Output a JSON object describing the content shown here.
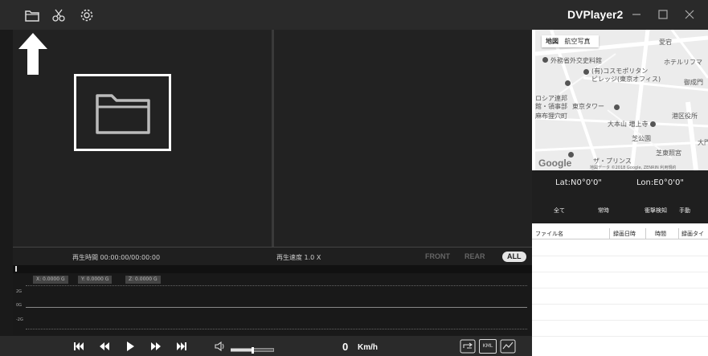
{
  "app": {
    "title": "DVPlayer2"
  },
  "toolbar": {
    "icons": [
      "folder-icon",
      "scissors-icon",
      "gear-icon"
    ]
  },
  "window_controls": [
    "minimize-icon",
    "maximize-icon",
    "close-icon"
  ],
  "status": {
    "playtime_label": "再生時間",
    "playtime_value": "00:00:00/00:00:00",
    "speed_label": "再生速度",
    "speed_value": "1.0 X",
    "view_buttons": [
      "FRONT",
      "REAR",
      "ALL"
    ],
    "active_view": "ALL"
  },
  "gsensor": {
    "x_label": "X: 0.0000 G",
    "y_label": "Y: 0.0000 G",
    "z_label": "Z: 0.0000 G",
    "ticks": [
      "2G",
      "0G",
      "-2G"
    ]
  },
  "controls": {
    "buttons": [
      "skip-start-icon",
      "rewind-icon",
      "play-icon",
      "fast-forward-icon",
      "skip-end-icon",
      "volume-icon"
    ],
    "volume_level": 0.5,
    "speed_value": "0",
    "speed_unit": "Km/h",
    "extra_buttons": [
      "loop-icon",
      "kml-icon",
      "chart-icon"
    ],
    "kml_text": "KML"
  },
  "map": {
    "tabs": [
      "地図",
      "航空写真"
    ],
    "active_tab": "地図",
    "labels": [
      "外務省外交史料館",
      "(有)コスモポリタン",
      "ビレッジ(東京オフィス)",
      "愛宕",
      "ホテルリフマ",
      "御成門",
      "ロシア連邦",
      "館・領事部",
      "東京タワー",
      "麻布狸穴町",
      "大本山 増上寺",
      "港区役所",
      "芝東照宮",
      "ザ・プリンス",
      "芝公園",
      "大門"
    ],
    "logo": "Google",
    "copyright": "地図データ ©2018 Google, ZENRIN  利用規約"
  },
  "coords": {
    "lat": "Lat:N0°0'0\"",
    "lon": "Lon:E0°0'0\""
  },
  "filters": [
    "全て",
    "常時",
    "衝撃検知",
    "手動"
  ],
  "file_list": {
    "columns": [
      "ファイル名",
      "録画日時",
      "時間",
      "録画タイ"
    ]
  }
}
